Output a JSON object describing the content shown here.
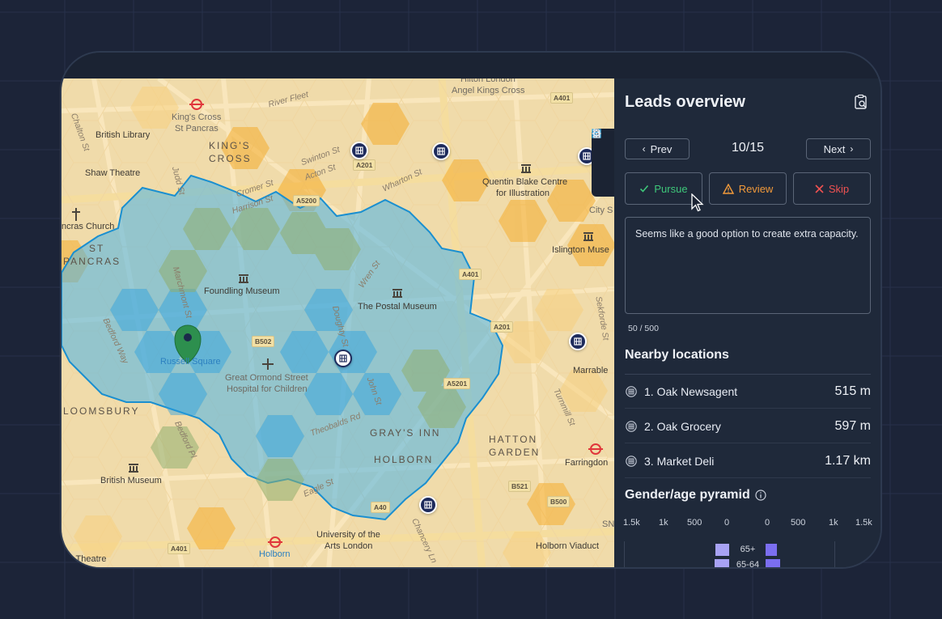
{
  "panel": {
    "title": "Leads overview",
    "prev_label": "Prev",
    "next_label": "Next",
    "counter": "10/15",
    "actions": {
      "pursue": "Pursue",
      "review": "Review",
      "skip": "Skip"
    },
    "note_text": "Seems like a good option to create extra capacity.",
    "char_count": "50 / 500",
    "nearby_title": "Nearby locations",
    "nearby": [
      {
        "name": "1. Oak Newsagent",
        "distance": "515 m"
      },
      {
        "name": "2. Oak Grocery",
        "distance": "597 m"
      },
      {
        "name": "3. Market Deli",
        "distance": "1.17 km"
      }
    ],
    "pyramid_title": "Gender/age pyramid",
    "pyramid_axis": [
      "1.5k",
      "1k",
      "500",
      "0",
      "0",
      "500",
      "1k",
      "1.5k"
    ],
    "pyramid_rows": [
      {
        "age": "65+",
        "male": 310,
        "female": 270
      },
      {
        "age": "65-64",
        "male": 340,
        "female": 330
      }
    ]
  },
  "map": {
    "labels": {
      "hilton": "Hilton London",
      "angel": "Angel Kings Cross",
      "river_fleet": "River Fleet",
      "kings_cross_station": "King's Cross",
      "st_pancras": "St Pancras",
      "british_library": "British Library",
      "chalton_st": "Chalton St",
      "shaw_theatre": "Shaw Theatre",
      "kings_cross_area_1": "KING'S",
      "kings_cross_area_2": "CROSS",
      "swinton_st": "Swinton St",
      "acton_st": "Acton St",
      "wharton_st": "Wharton St",
      "quentin_1": "Quentin Blake Centre",
      "quentin_2": "for Illustration",
      "city_s": "City S",
      "cromer_st": "Cromer St",
      "harrison_st": "Harrison St",
      "judd_st": "Judd St",
      "st_pancras_church": "ncras Church",
      "st_label": "ST",
      "pancras_label": "PANCRAS",
      "islington_museum": "Islington Muse",
      "foundling_museum": "Foundling Museum",
      "wren_st": "Wren St",
      "postal_museum": "The Postal Museum",
      "marchmont_st": "Marchmont St",
      "bedford_way": "Bedford Way",
      "russell_square": "Russell Square",
      "great_ormond_1": "Great Ormond Street",
      "great_ormond_2": "Hospital for Children",
      "doughty_st": "Doughty St",
      "john_st": "John St",
      "sekforde_st": "Sekforde St",
      "marrable": "Marrable",
      "bloomsbury": "LOOMSBURY",
      "theobalds_rd": "Theobalds Rd",
      "grays_inn": "GRAY'S INN",
      "hatton_1": "HATTON",
      "hatton_2": "GARDEN",
      "turnmill_st": "Turnmill St",
      "bedford_pl": "Bedford Pl",
      "holborn_area": "HOLBORN",
      "farringdon": "Farringdon",
      "british_museum": "British Museum",
      "eagle_st": "Eagle St",
      "ual_1": "University of the",
      "ual_2": "Arts London",
      "chancery_ln": "Chancery Ln",
      "holborn_viaduct": "Holborn Viaduct",
      "holborn_station": "Holborn",
      "sn": "SN",
      "ion_theatre": "ion Theatre"
    },
    "roads": {
      "a401_top": "A401",
      "a201_top": "A201",
      "a5200": "A5200",
      "a401_mid": "A401",
      "a201_mid": "A201",
      "b502": "B502",
      "a5201": "A5201",
      "b521": "B521",
      "b500": "B500",
      "a40": "A40",
      "a401_bottom": "A401"
    }
  },
  "colors": {
    "accent_blue": "#3ab0e8",
    "pursue_green": "#3ec77a",
    "review_orange": "#f29a3a",
    "skip_red": "#f05252",
    "male_bar": "#a8a2f4",
    "female_bar": "#7b6ef0",
    "hex_orange": "#f5b642",
    "marker_navy": "#1e2b5c"
  },
  "icons": {
    "map_list": "list-icon",
    "map_doc": "document-icon",
    "map_settings": "gear-icon",
    "clipboard": "clipboard-search-icon",
    "store": "store-icon",
    "pin": "location-pin-icon",
    "info": "info-icon"
  }
}
